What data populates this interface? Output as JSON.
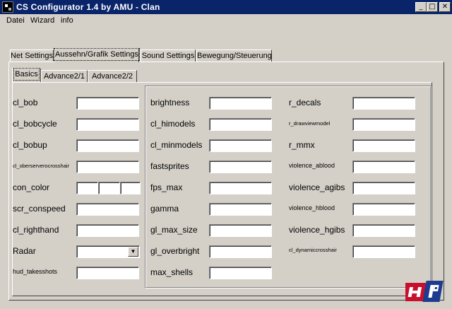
{
  "window": {
    "title": "CS Configurator 1.4 by AMU - Clan",
    "buttons": {
      "minimize": "_",
      "maximize": "□",
      "close": "✕"
    }
  },
  "menu": {
    "items": [
      "Datei",
      "Wizard",
      "info"
    ]
  },
  "main_tabs": [
    "Net Settings",
    "Aussehn/Grafik Settings",
    "Sound Settings",
    "Bewegung/Steuerung"
  ],
  "main_tab_selected": "Aussehn/Grafik Settings",
  "sub_tabs": [
    "Basics",
    "Advance2/1",
    "Advance2/2"
  ],
  "sub_tab_selected": "Basics",
  "column1": [
    {
      "label": "cl_bob",
      "value": ""
    },
    {
      "label": "cl_bobcycle",
      "value": ""
    },
    {
      "label": "cl_bobup",
      "value": ""
    },
    {
      "label": "cl_oberserverocrosshair",
      "value": ""
    },
    {
      "label": "con_color",
      "value": ""
    },
    {
      "label": "scr_conspeed",
      "value": ""
    },
    {
      "label": "cl_righthand",
      "value": ""
    },
    {
      "label": "Radar",
      "value": ""
    },
    {
      "label": "hud_takesshots",
      "value": ""
    }
  ],
  "column2": [
    {
      "label": "brightness",
      "value": ""
    },
    {
      "label": "cl_himodels",
      "value": ""
    },
    {
      "label": "cl_minmodels",
      "value": ""
    },
    {
      "label": "fastsprites",
      "value": ""
    },
    {
      "label": "fps_max",
      "value": ""
    },
    {
      "label": "gamma",
      "value": ""
    },
    {
      "label": "gl_max_size",
      "value": ""
    },
    {
      "label": "gl_overbright",
      "value": ""
    },
    {
      "label": "max_shells",
      "value": ""
    }
  ],
  "column3": [
    {
      "label": "r_decals",
      "value": ""
    },
    {
      "label": "r_drawviewmodel",
      "value": ""
    },
    {
      "label": "r_mmx",
      "value": ""
    },
    {
      "label": "violence_ablood",
      "value": ""
    },
    {
      "label": "violence_agibs",
      "value": ""
    },
    {
      "label": "violence_hblood",
      "value": ""
    },
    {
      "label": "violence_hgibs",
      "value": ""
    },
    {
      "label": "cl_dynamiccrosshair",
      "value": ""
    }
  ],
  "colors": {
    "titlebar": "#0a246a",
    "face": "#d4d0c8",
    "logo_red": "#c8102e",
    "logo_blue": "#1d3c8f"
  }
}
